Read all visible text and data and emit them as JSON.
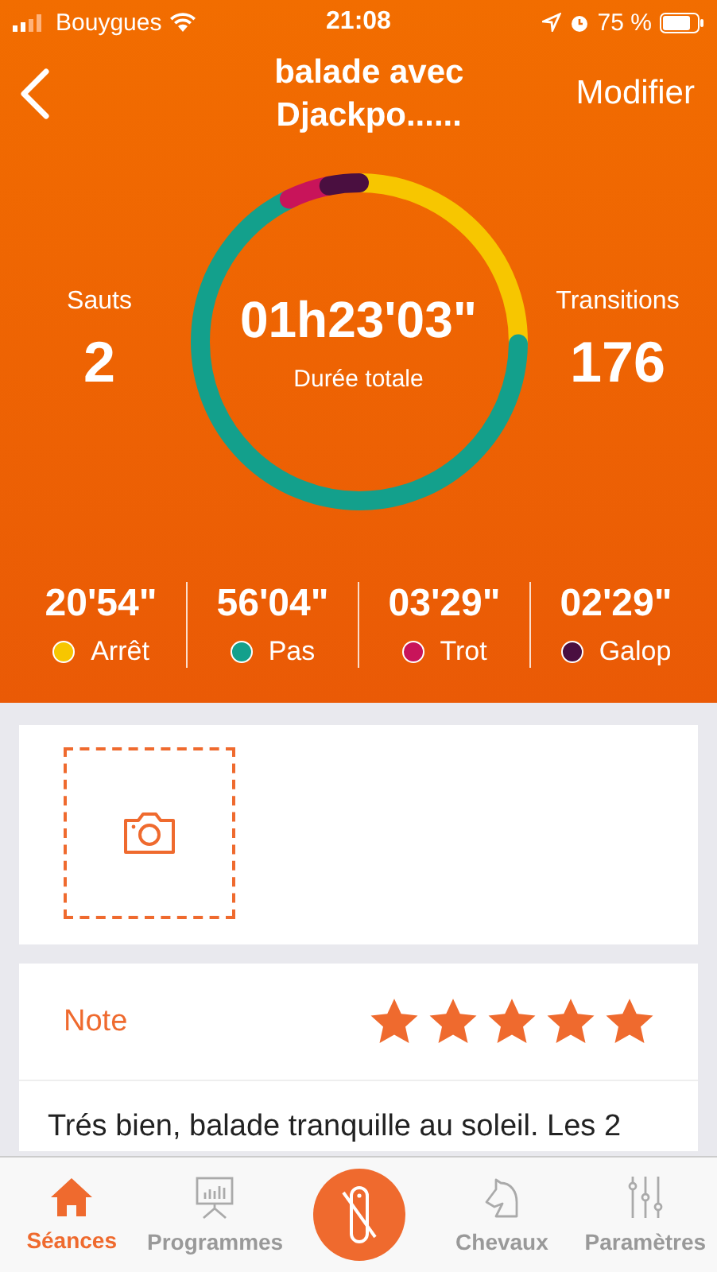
{
  "status_bar": {
    "carrier": "Bouygues",
    "time": "21:08",
    "battery": "75 %"
  },
  "nav": {
    "title": "balade avec Djackpo......",
    "action": "Modifier"
  },
  "summary": {
    "left_label": "Sauts",
    "left_value": "2",
    "total": "01h23'03\"",
    "total_label": "Durée totale",
    "right_label": "Transitions",
    "right_value": "176"
  },
  "gaits": [
    {
      "time": "20'54\"",
      "label": "Arrêt",
      "color": "#f7c600"
    },
    {
      "time": "56'04\"",
      "label": "Pas",
      "color": "#13a08c"
    },
    {
      "time": "03'29\"",
      "label": "Trot",
      "color": "#c8145a"
    },
    {
      "time": "02'29\"",
      "label": "Galop",
      "color": "#4a0f40"
    }
  ],
  "note": {
    "label": "Note",
    "stars": 5,
    "text": "Trés bien, balade tranquille au soleil. Les 2"
  },
  "tabs": [
    {
      "label": "Séances",
      "selected": true,
      "kind": "home"
    },
    {
      "label": "Programmes",
      "selected": false,
      "kind": "board"
    },
    {
      "selected": false,
      "kind": "center"
    },
    {
      "label": "Chevaux",
      "selected": false,
      "kind": "horse"
    },
    {
      "label": "Paramètres",
      "selected": false,
      "kind": "sliders"
    }
  ]
}
